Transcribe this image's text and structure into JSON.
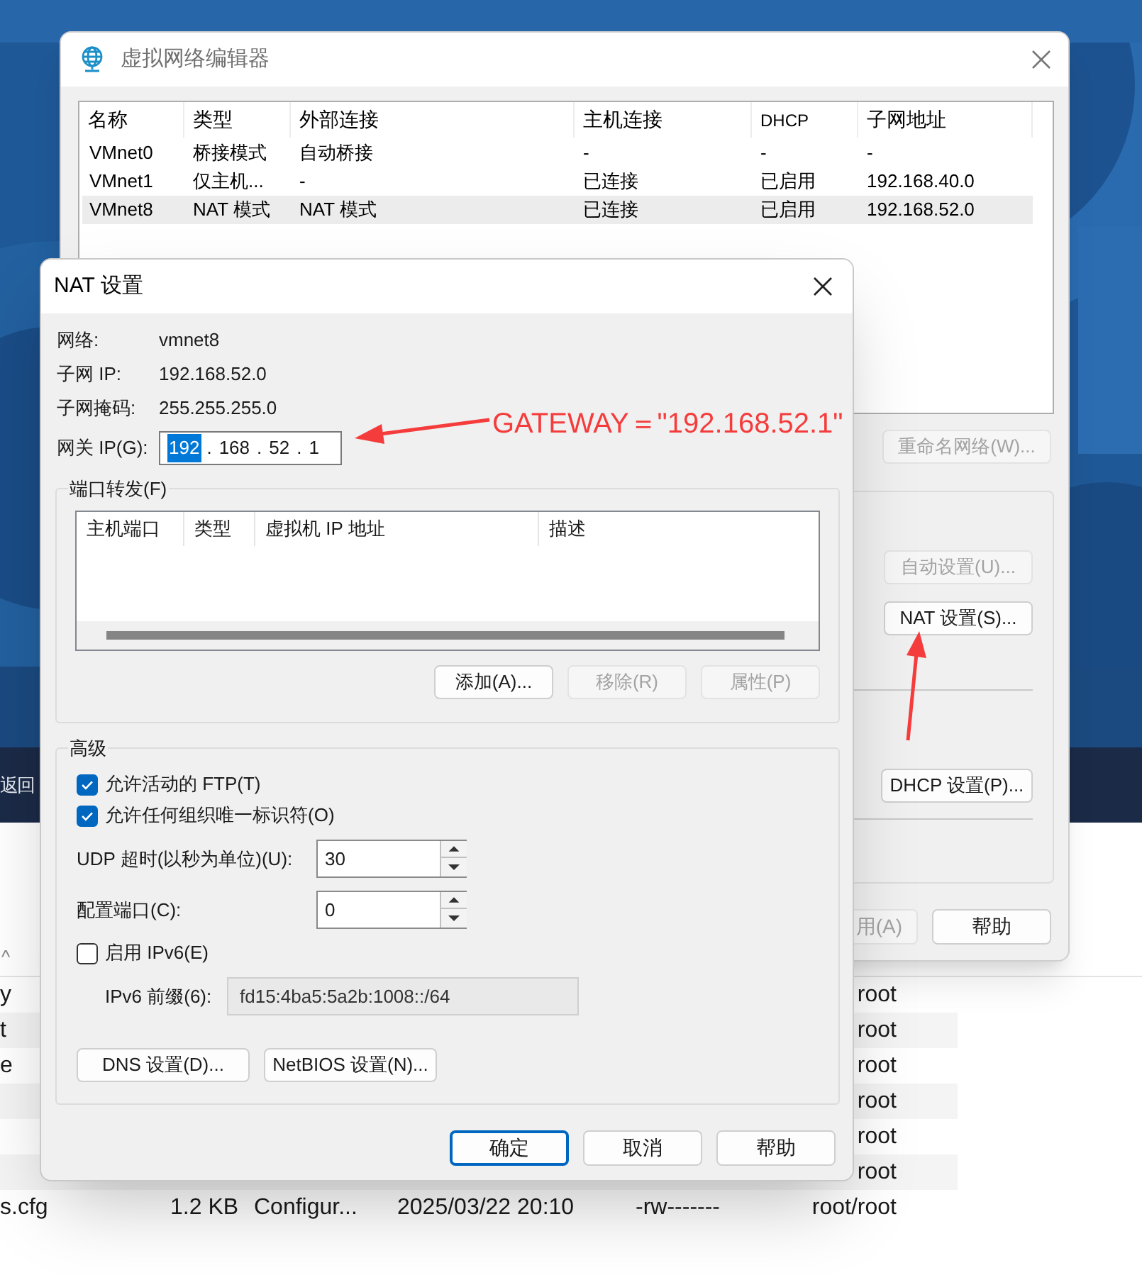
{
  "desktop": {
    "back_label": "返回"
  },
  "file_list": {
    "sort_indicator": "^",
    "rows": [
      {
        "name": "y",
        "owner": "root"
      },
      {
        "name": "t",
        "owner": "root"
      },
      {
        "name": "e",
        "owner": "root"
      },
      {
        "owner": "root"
      },
      {
        "owner": "root"
      },
      {
        "owner": "root"
      },
      {
        "name": "s.cfg",
        "size": "1.2 KB",
        "type": "Configur...",
        "modified": "2025/03/22 20:10",
        "permissions": "-rw-------",
        "owner": "root/root"
      }
    ]
  },
  "network_editor": {
    "title": "虚拟网络编辑器",
    "table": {
      "columns": [
        "名称",
        "类型",
        "外部连接",
        "主机连接",
        "DHCP",
        "子网地址"
      ],
      "rows": [
        {
          "cells": [
            "VMnet0",
            "桥接模式",
            "自动桥接",
            "-",
            "-",
            "-"
          ],
          "selected": false
        },
        {
          "cells": [
            "VMnet1",
            "仅主机...",
            "-",
            "已连接",
            "已启用",
            "192.168.40.0"
          ],
          "selected": false
        },
        {
          "cells": [
            "VMnet8",
            "NAT 模式",
            "NAT 模式",
            "已连接",
            "已启用",
            "192.168.52.0"
          ],
          "selected": true
        }
      ]
    },
    "rename_button": {
      "label": "重命名网络(W)...",
      "disabled": true
    },
    "side_buttons": [
      {
        "label": "自动设置(U)...",
        "disabled": true
      },
      {
        "label": "NAT 设置(S)...",
        "disabled": false
      },
      {
        "label": "DHCP 设置(P)...",
        "disabled": false
      }
    ],
    "footer_buttons": [
      {
        "label": "用(A)",
        "disabled": true
      },
      {
        "label": "帮助",
        "disabled": false
      }
    ]
  },
  "nat_settings": {
    "title": "NAT 设置",
    "info": [
      {
        "label": "网络:",
        "value": "vmnet8"
      },
      {
        "label": "子网 IP:",
        "value": "192.168.52.0"
      },
      {
        "label": "子网掩码:",
        "value": "255.255.255.0"
      }
    ],
    "gateway": {
      "label": "网关 IP(G):",
      "separator": ".",
      "octets": [
        {
          "value": "192",
          "selected": true
        },
        {
          "value": "168",
          "selected": false
        },
        {
          "value": "52",
          "selected": false
        },
        {
          "value": "1",
          "selected": false
        }
      ]
    },
    "port_forwarding": {
      "title": "端口转发(F)",
      "columns": [
        "主机端口",
        "类型",
        "虚拟机 IP 地址",
        "描述"
      ],
      "buttons": [
        {
          "label": "添加(A)...",
          "disabled": false
        },
        {
          "label": "移除(R)",
          "disabled": true
        },
        {
          "label": "属性(P)",
          "disabled": true
        }
      ]
    },
    "advanced": {
      "title": "高级",
      "options": [
        {
          "kind": "checkbox",
          "label": "允许活动的 FTP(T)",
          "checked": true
        },
        {
          "kind": "checkbox",
          "label": "允许任何组织唯一标识符(O)",
          "checked": true
        },
        {
          "kind": "spinner",
          "label": "UDP 超时(以秒为单位)(U):",
          "value": "30"
        },
        {
          "kind": "spinner",
          "label": "配置端口(C):",
          "value": "0"
        },
        {
          "kind": "checkbox",
          "label": "启用 IPv6(E)",
          "checked": false
        },
        {
          "kind": "field",
          "label": "IPv6 前缀(6):",
          "value": "fd15:4ba5:5a2b:1008::/64",
          "disabled": true
        }
      ],
      "buttons": [
        {
          "label": "DNS 设置(D)..."
        },
        {
          "label": "NetBIOS 设置(N)..."
        }
      ]
    },
    "footer_buttons": [
      {
        "label": "确定",
        "default": true
      },
      {
        "label": "取消",
        "default": false
      },
      {
        "label": "帮助",
        "default": false
      }
    ]
  },
  "annotations": [
    {
      "kind": "callout",
      "text": "GATEWAY＝\"192.168.52.1\""
    },
    {
      "kind": "arrow"
    },
    {
      "kind": "arrow"
    }
  ]
}
